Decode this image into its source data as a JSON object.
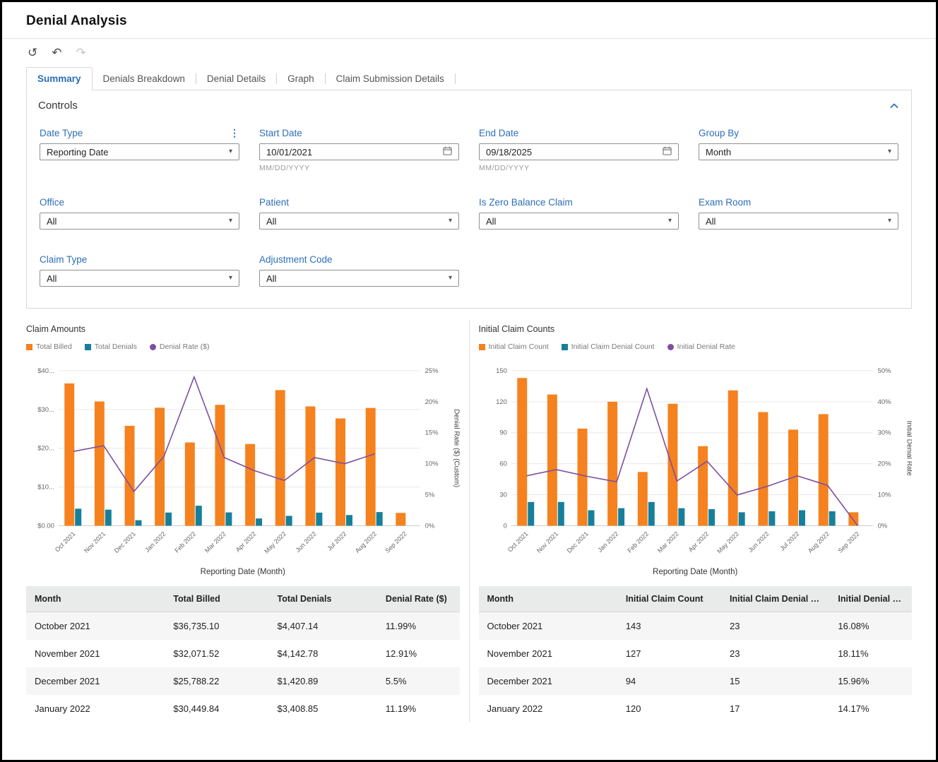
{
  "theme": {
    "accent_blue": "#2d6fb7",
    "bar_orange": "#f5821f",
    "bar_teal": "#16809c",
    "line_purple": "#7d4fa0"
  },
  "page": {
    "title": "Denial Analysis"
  },
  "toolbar": {
    "reset_icon": "↺",
    "undo_icon": "↶",
    "redo_icon": "↷"
  },
  "tabs": [
    {
      "label": "Summary",
      "active": true
    },
    {
      "label": "Denials Breakdown",
      "active": false
    },
    {
      "label": "Denial Details",
      "active": false
    },
    {
      "label": "Graph",
      "active": false
    },
    {
      "label": "Claim Submission Details",
      "active": false
    }
  ],
  "controls": {
    "title": "Controls",
    "fields": [
      {
        "label": "Date Type",
        "value": "Reporting Date"
      },
      {
        "label": "Start Date",
        "value": "10/01/2021",
        "hint": "MM/DD/YYYY"
      },
      {
        "label": "End Date",
        "value": "09/18/2025",
        "hint": "MM/DD/YYYY"
      },
      {
        "label": "Group By",
        "value": "Month"
      },
      {
        "label": "Office",
        "value": "All"
      },
      {
        "label": "Patient",
        "value": "All"
      },
      {
        "label": "Is Zero Balance Claim",
        "value": "All"
      },
      {
        "label": "Exam Room",
        "value": "All"
      },
      {
        "label": "Claim Type",
        "value": "All"
      },
      {
        "label": "Adjustment Code",
        "value": "All"
      }
    ]
  },
  "chart_data": [
    {
      "type": "bar",
      "title": "Claim Amounts",
      "categories": [
        "Oct 2021",
        "Nov 2021",
        "Dec 2021",
        "Jan 2022",
        "Feb 2022",
        "Mar 2022",
        "Apr 2022",
        "May 2022",
        "Jun 2022",
        "Jul 2022",
        "Aug 2022",
        "Sep 2022"
      ],
      "series": [
        {
          "name": "Total Billed",
          "type": "bar",
          "axis": "left",
          "color": "#f5821f",
          "values": [
            36735.1,
            32071.52,
            25788.22,
            30449.84,
            21500,
            31200,
            21100,
            35000,
            30800,
            27700,
            30400,
            3300
          ]
        },
        {
          "name": "Total Denials",
          "type": "bar",
          "axis": "left",
          "color": "#16809c",
          "values": [
            4407.14,
            4142.78,
            1420.89,
            3408.85,
            5160,
            3430,
            1880,
            2550,
            3390,
            2770,
            3530,
            0
          ]
        },
        {
          "name": "Denial Rate ($)",
          "type": "line",
          "axis": "right",
          "color": "#7d4fa0",
          "values": [
            11.99,
            12.91,
            5.51,
            11.19,
            24.0,
            11.0,
            8.9,
            7.3,
            11.0,
            10.0,
            11.6,
            null
          ]
        }
      ],
      "left_axis": {
        "max": 40000,
        "ticks": [
          "$0.00",
          "$10...",
          "$20...",
          "$30...",
          "$40..."
        ]
      },
      "right_axis": {
        "max": 25,
        "ticks": [
          "0%",
          "5%",
          "10%",
          "15%",
          "20%",
          "25%"
        ],
        "label": "Denial Rate ($) (Custom)"
      },
      "xlabel": "Reporting Date (Month)",
      "grid": true,
      "legend_position": "top-left"
    },
    {
      "type": "bar",
      "title": "Initial Claim Counts",
      "categories": [
        "Oct 2021",
        "Nov 2021",
        "Dec 2021",
        "Jan 2022",
        "Feb 2022",
        "Mar 2022",
        "Apr 2022",
        "May 2022",
        "Jun 2022",
        "Jul 2022",
        "Aug 2022",
        "Sep 2022"
      ],
      "series": [
        {
          "name": "Initial Claim Count",
          "type": "bar",
          "axis": "left",
          "color": "#f5821f",
          "values": [
            143,
            127,
            94,
            120,
            52,
            118,
            77,
            131,
            110,
            93,
            108,
            13
          ]
        },
        {
          "name": "Initial Claim Denial Count",
          "type": "bar",
          "axis": "left",
          "color": "#16809c",
          "values": [
            23,
            23,
            15,
            17,
            23,
            17,
            16,
            13,
            14,
            15,
            14,
            0
          ]
        },
        {
          "name": "Initial Denial Rate",
          "type": "line",
          "axis": "right",
          "color": "#7d4fa0",
          "values": [
            16.08,
            18.11,
            15.96,
            14.17,
            44.2,
            14.4,
            20.8,
            9.9,
            12.7,
            16.1,
            13.0,
            0
          ]
        }
      ],
      "left_axis": {
        "max": 150,
        "ticks": [
          "0",
          "30",
          "60",
          "90",
          "120",
          "150"
        ]
      },
      "right_axis": {
        "max": 50,
        "ticks": [
          "0%",
          "10%",
          "20%",
          "30%",
          "40%",
          "50%"
        ],
        "label": "Initial Denial Rate"
      },
      "xlabel": "Reporting Date (Month)",
      "grid": true,
      "legend_position": "top-left"
    }
  ],
  "tables": [
    {
      "headers": [
        "Month",
        "Total Billed",
        "Total Denials",
        "Denial Rate ($)"
      ],
      "rows": [
        [
          "October 2021",
          "$36,735.10",
          "$4,407.14",
          "11.99%"
        ],
        [
          "November 2021",
          "$32,071.52",
          "$4,142.78",
          "12.91%"
        ],
        [
          "December 2021",
          "$25,788.22",
          "$1,420.89",
          "5.5%"
        ],
        [
          "January 2022",
          "$30,449.84",
          "$3,408.85",
          "11.19%"
        ]
      ]
    },
    {
      "headers": [
        "Month",
        "Initial Claim Count",
        "Initial Claim Denial Count",
        "Initial Denial Rate"
      ],
      "rows": [
        [
          "October 2021",
          "143",
          "23",
          "16.08%"
        ],
        [
          "November 2021",
          "127",
          "23",
          "18.11%"
        ],
        [
          "December 2021",
          "94",
          "15",
          "15.96%"
        ],
        [
          "January 2022",
          "120",
          "17",
          "14.17%"
        ]
      ]
    }
  ]
}
